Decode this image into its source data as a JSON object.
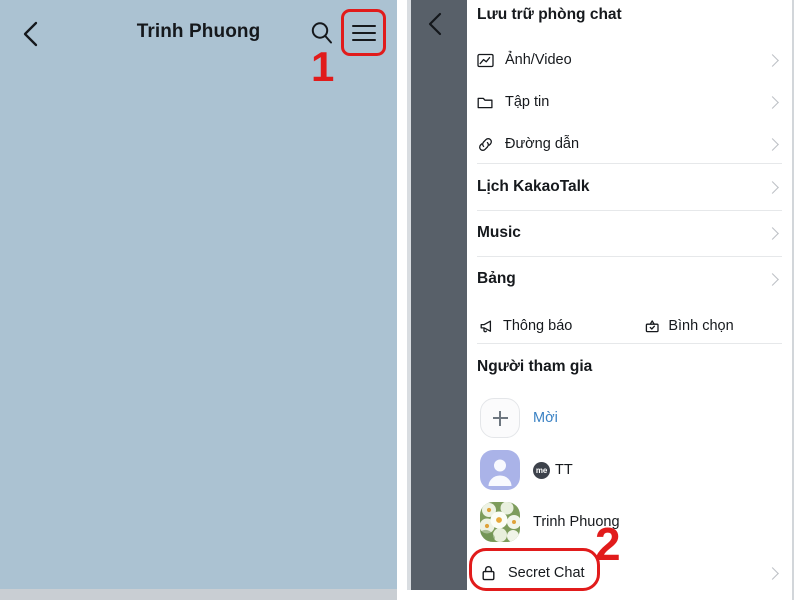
{
  "left_panel": {
    "back_icon": "chevron-left-icon",
    "title": "Trinh Phuong",
    "search_icon": "search-icon",
    "menu_icon": "hamburger-menu-icon",
    "background_color": "#abc2d2"
  },
  "annotations": [
    {
      "number": "1",
      "target": "hamburger-menu-icon",
      "color": "#e11b1b"
    },
    {
      "number": "2",
      "target": "secret-chat-row",
      "color": "#e11b1b"
    }
  ],
  "right_panel": {
    "back_icon": "chevron-left-icon",
    "dim_overlay_color": "#586069",
    "sheet_title": "Lưu trữ phòng chat",
    "archive_items": [
      {
        "label": "Ảnh/Video",
        "icon": "photo-video-icon",
        "chevron": "chevron-right-icon"
      },
      {
        "label": "Tập tin",
        "icon": "folder-icon",
        "chevron": "chevron-right-icon"
      },
      {
        "label": "Đường dẫn",
        "icon": "link-icon",
        "chevron": "chevron-right-icon"
      }
    ],
    "section_items": [
      {
        "label": "Lịch KakaoTalk",
        "chevron": "chevron-right-icon"
      },
      {
        "label": "Music",
        "chevron": "chevron-right-icon"
      },
      {
        "label": "Bảng",
        "chevron": "chevron-right-icon"
      }
    ],
    "dual_row": [
      {
        "label": "Thông báo",
        "icon": "megaphone-icon"
      },
      {
        "label": "Bình chọn",
        "icon": "poll-ballot-icon"
      }
    ],
    "participants_title": "Người tham gia",
    "invite": {
      "label": "Mời",
      "icon": "plus-icon",
      "label_color": "#3b82c4"
    },
    "members": [
      {
        "name": "TT",
        "badge": "me",
        "avatar": "default-person-avatar"
      },
      {
        "name": "Trinh Phuong",
        "badge": "",
        "avatar": "flower-photo-avatar"
      }
    ],
    "secret_chat": {
      "label": "Secret Chat",
      "icon": "lock-icon",
      "chevron": "chevron-right-icon"
    }
  }
}
